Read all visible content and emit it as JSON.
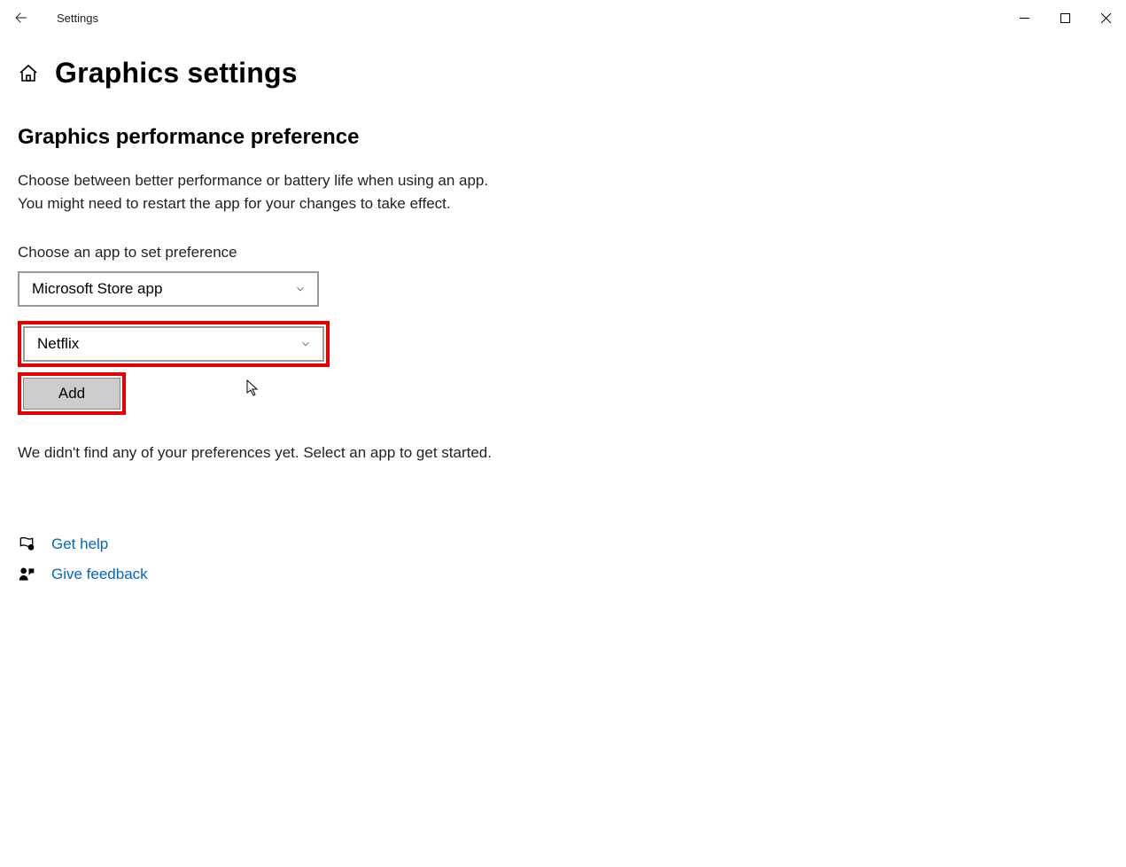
{
  "window": {
    "app_name": "Settings"
  },
  "page": {
    "title": "Graphics settings",
    "section_title": "Graphics performance preference",
    "description": "Choose between better performance or battery life when using an app. You might need to restart the app for your changes to take effect.",
    "choose_label": "Choose an app to set preference",
    "dropdown1": "Microsoft Store app",
    "dropdown2": "Netflix",
    "add_button": "Add",
    "empty_state": "We didn't find any of your preferences yet. Select an app to get started."
  },
  "links": {
    "help": "Get help",
    "feedback": "Give feedback"
  }
}
